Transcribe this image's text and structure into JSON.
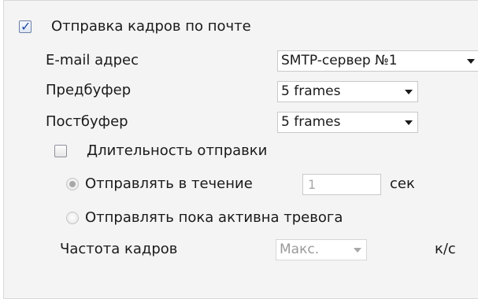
{
  "send_frames": {
    "checked": true,
    "label": "Отправка кадров по почте"
  },
  "email": {
    "label": "E-mail адрес",
    "value": "SMTP-сервер №1"
  },
  "prebuffer": {
    "label": "Предбуфер",
    "value": "5 frames"
  },
  "postbuffer": {
    "label": "Постбуфер",
    "value": "5 frames"
  },
  "duration": {
    "checked": false,
    "label": "Длительность отправки"
  },
  "send_during": {
    "selected": true,
    "label": "Отправлять в течение",
    "value": "1",
    "unit": "сек"
  },
  "send_while_alarm": {
    "selected": false,
    "label": "Отправлять пока активна тревога"
  },
  "frame_rate": {
    "label": "Частота кадров",
    "value": "Макс.",
    "unit": "к/с"
  }
}
